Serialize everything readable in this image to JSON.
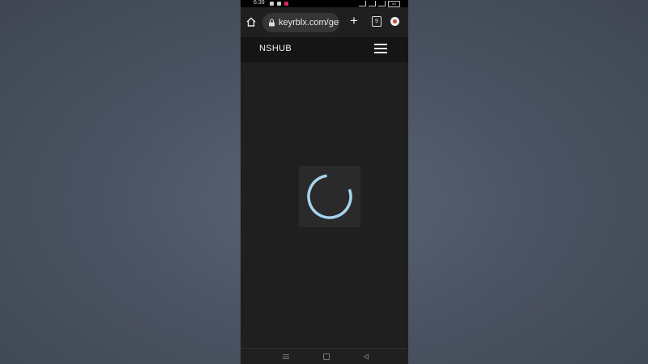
{
  "status_bar": {
    "time": "6:39",
    "battery": "69",
    "icons": [
      "signal-icon",
      "wifi-icon",
      "settings-icon",
      "notification-icon"
    ]
  },
  "browser": {
    "url": "keyrblx.com/getk",
    "tab_count": "9"
  },
  "site": {
    "title": "NSHUB"
  },
  "colors": {
    "page_background": "#1f1f1f",
    "header_background": "#151515",
    "spinner": "#a7d3ef",
    "loader_box": "#2a2a2a"
  }
}
